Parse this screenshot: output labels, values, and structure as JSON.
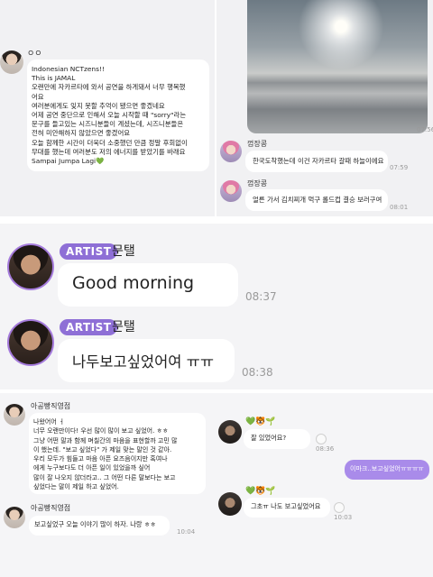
{
  "panel1": {
    "sender_name": "ㅇㅇ",
    "message_lines": [
      "Indonesian NCTzens!!",
      "This is JAMAL",
      "오랜만에 자카르타에 와서 공연을 하게돼서 너무 행복했",
      "어요",
      "여러분에게도 잊지 못할 추억이 됐으면 좋겠네요",
      "어제 공연 중단으로 인해서 오늘 시작할 때 \"sorry\"라는",
      "문구를 들고있는 시즈니분들이 계셨는데, 시즈니분들은",
      "전혀 미안해하지 않았으면 좋겠어요",
      "오늘 함께한 시간이 더욱더 소중했던 만큼 정말 후회없이",
      "무대를 했는데 여러분도 저의 에너지를 받았기를 바래요",
      "Sampai Jumpa Lagi💚"
    ]
  },
  "panel2": {
    "image_time": "07:56",
    "sender_name": "껌장콩",
    "messages": [
      {
        "text": "한국도착했는데 이건 자카르타 갈때 하늘이에요",
        "time": "07:59"
      },
      {
        "text": "얼른 가서 김치찌개 먹구 롤드컵 결승 보러구여",
        "time": "08:01"
      }
    ]
  },
  "panel3": {
    "badge": "ARTIST",
    "sender_name": "문탤",
    "messages": [
      {
        "text": "Good morning",
        "time": "08:37"
      },
      {
        "text": "나두보고싶었어여 ㅠㅠ",
        "time": "08:38"
      }
    ]
  },
  "panel4": {
    "sender_name": "아공빵직영점",
    "message1_lines": [
      "나왔어어 ㅓ",
      "너무 오랜만이다! 우선 많이 많이 보고 싶었어. ㅎㅎ",
      "그냥 어떤 말과 함께 며칠간의 마음을 표현할까 고민 많",
      "이 했는데. \"보고 싶었다\" 가 제일 맞는 말인 것 같아.",
      "우리 모두가 힘들고 마음 아픈 요즈음이지만 혹여나",
      "에게 누구보다도 더 아픈 일이 있었을까 싶어",
      "많이 잘 나오지 않더라고.. 그 어떤 다른 말보다는 보고",
      "싶었다는 말이 제일 하고 싶었어."
    ],
    "sender_name_2": "아공빵직영점",
    "message2": "보고싶었구 오늘 이야기 많이 하자. 나랑 ㅎㅎ",
    "message2_time": "10:04"
  },
  "panel5": {
    "reaction_icons": "💚🐯🌱",
    "messages": [
      {
        "text": "잘 있었어요?",
        "time": "08:36"
      },
      {
        "text": "이마크..보고싶었어ㅠㅠㅠㅠ",
        "mine": true
      },
      {
        "text": "그초ㅠ 나도 보고싶었어요",
        "time": "10:03"
      }
    ]
  },
  "colors": {
    "artist_badge": "#8e6fd6",
    "my_bubble": "#a98bea",
    "bubble": "#ffffff"
  }
}
